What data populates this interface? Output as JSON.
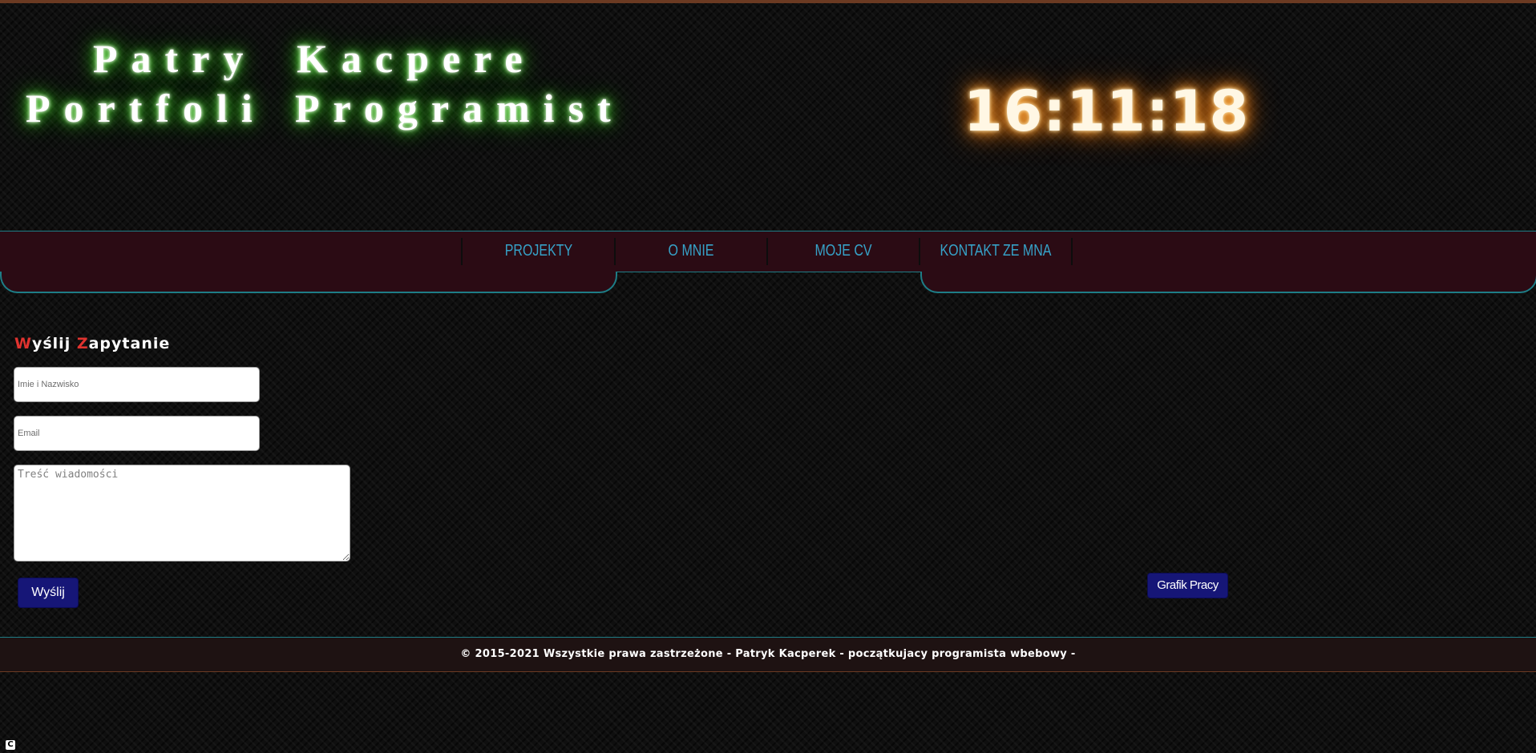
{
  "header": {
    "line1": [
      "Patry",
      "Kacpere"
    ],
    "line2": [
      "Portfoli",
      "Programist"
    ],
    "clock": "16:11:18"
  },
  "nav": {
    "items": [
      "PROJEKTY",
      "O MNIE",
      "MOJE CV",
      "KONTAKT ZE MNA"
    ]
  },
  "form": {
    "title_first_letter": "W",
    "title_word1_rest": "yślij ",
    "title_second_letter": "Z",
    "title_word2_rest": "apytanie",
    "name_placeholder": "Imie i Nazwisko",
    "email_placeholder": "Email",
    "message_placeholder": "Treść wiadomości",
    "send_label": "Wyślij"
  },
  "schedule_button_label": "Grafik Pracy",
  "footer": {
    "text": "© 2015-2021 Wszystkie prawa zastrzeżone - Patryk Kacperek - początkujacy programista wbebowy -"
  },
  "corner_icon_glyph": "C",
  "colors": {
    "nav_text": "#36a2c8",
    "nav_background": "#2b0b14",
    "accent_border": "#1e7d86",
    "title_highlight": "#e0332f",
    "button_background": "#161677",
    "header_glow": "#36d41c",
    "clock_glow": "#ff8a1c"
  }
}
